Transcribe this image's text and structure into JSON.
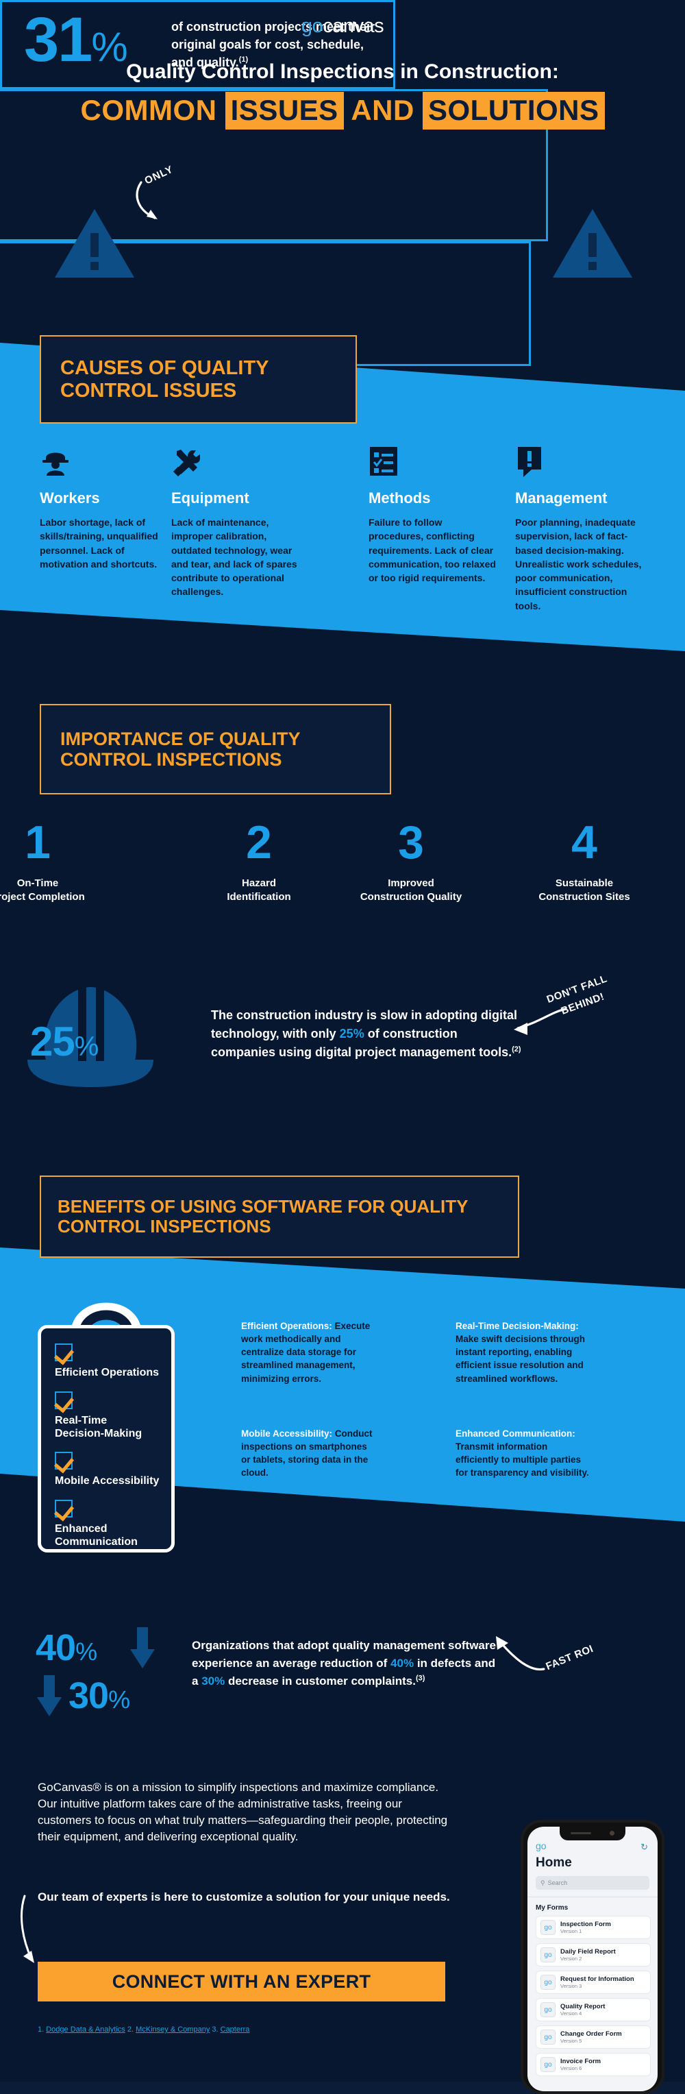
{
  "brand": {
    "logo_go": "go",
    "logo_canvas": "canvas",
    "accent_orange": "#fba12e",
    "accent_blue": "#1b9fe8",
    "bg_navy": "#081730"
  },
  "header": {
    "subtitle": "Quality Control Inspections in Construction:",
    "title_part1": "COMMON",
    "title_part2": "ISSUES",
    "title_part3": "AND",
    "title_part4": "SOLUTIONS"
  },
  "stat_31": {
    "callout": "ONLY",
    "number": "31",
    "percent": "%",
    "text": "of construction projects meet their original goals for cost, schedule, and quality.",
    "footnote": "(1)"
  },
  "causes": {
    "heading": "CAUSES OF QUALITY CONTROL ISSUES",
    "items": [
      {
        "icon": "worker-helmet-icon",
        "title": "Workers",
        "body": "Labor shortage, lack of skills/training, unqualified personnel. Lack of motivation and shortcuts."
      },
      {
        "icon": "tools-wrench-screwdriver-icon",
        "title": "Equipment",
        "body": "Lack of maintenance, improper calibration, outdated technology, wear and tear, and lack of spares contribute to operational challenges."
      },
      {
        "icon": "checklist-icon",
        "title": "Methods",
        "body": "Failure to follow procedures, conflicting requirements. Lack of clear communication, too relaxed or too rigid requirements."
      },
      {
        "icon": "exclamation-speech-bubble-icon",
        "title": "Management",
        "body": "Poor planning, inadequate supervision, lack of fact-based decision-making. Unrealistic work schedules, poor communication, insufficient construction tools."
      }
    ]
  },
  "importance": {
    "heading": "IMPORTANCE OF QUALITY CONTROL INSPECTIONS",
    "items": [
      {
        "number": "1",
        "label": "On-Time\nProject Completion"
      },
      {
        "number": "2",
        "label": "Hazard\nIdentification"
      },
      {
        "number": "3",
        "label": "Improved\nConstruction Quality"
      },
      {
        "number": "4",
        "label": "Sustainable\nConstruction Sites"
      }
    ]
  },
  "stat_25": {
    "number": "25",
    "percent": "%",
    "text_a": "The construction industry is slow in adopting digital technology, with only ",
    "highlight": "25%",
    "text_b": " of construction companies using digital project management tools.",
    "footnote": "(2)",
    "callout_line1": "DON'T FALL",
    "callout_line2": "BEHIND!"
  },
  "benefits": {
    "heading": "BENEFITS OF USING SOFTWARE FOR QUALITY CONTROL INSPECTIONS",
    "checklist": [
      "Efficient Operations",
      "Real-Time\nDecision-Making",
      "Mobile Accessibility",
      "Enhanced\nCommunication"
    ],
    "items": [
      {
        "title": "Efficient Operations:",
        "body": "Execute work methodically and centralize data storage for streamlined management, minimizing errors."
      },
      {
        "title": "Real-Time Decision-Making:",
        "body": "Make swift decisions through instant reporting, enabling efficient issue resolution and streamlined workflows."
      },
      {
        "title": "Mobile Accessibility:",
        "body": "Conduct inspections on smartphones or tablets, storing data in the cloud."
      },
      {
        "title": "Enhanced Communication:",
        "body": "Transmit information efficiently to multiple parties for transparency and visibility."
      }
    ]
  },
  "stat_4030": {
    "num40": "40",
    "num30": "30",
    "percent": "%",
    "text_a": "Organizations that adopt quality management software experience an average reduction of ",
    "hl40": "40%",
    "text_b": " in defects and a ",
    "hl30": "30%",
    "text_c": " decrease in customer complaints.",
    "footnote": "(3)",
    "callout": "FAST ROI"
  },
  "closing": {
    "paragraph1": "GoCanvas® is on a mission to simplify inspections and maximize compliance. Our intuitive platform takes care of the administrative tasks, freeing our customers to focus on what truly matters—safeguarding their people, protecting their equipment, and delivering exceptional quality.",
    "paragraph2": "Our team of experts is here to customize a solution for your unique needs.",
    "cta_label": "CONNECT WITH AN EXPERT"
  },
  "footnotes": {
    "prefix1": "1. ",
    "source1": "Dodge Data & Analytics",
    "prefix2": " 2. ",
    "source2": "McKinsey & Company",
    "prefix3": " 3. ",
    "source3": "Capterra"
  },
  "phone": {
    "logo": "go",
    "refresh_icon": "refresh-icon",
    "title": "Home",
    "search_placeholder": "Search",
    "section_label": "My Forms",
    "forms": [
      {
        "name": "Inspection Form",
        "version": "Version 1"
      },
      {
        "name": "Daily Field Report",
        "version": "Version 2"
      },
      {
        "name": "Request for Information",
        "version": "Version 3"
      },
      {
        "name": "Quality Report",
        "version": "Version 4"
      },
      {
        "name": "Change Order Form",
        "version": "Version 5"
      },
      {
        "name": "Invoice Form",
        "version": "Version 6"
      }
    ]
  }
}
